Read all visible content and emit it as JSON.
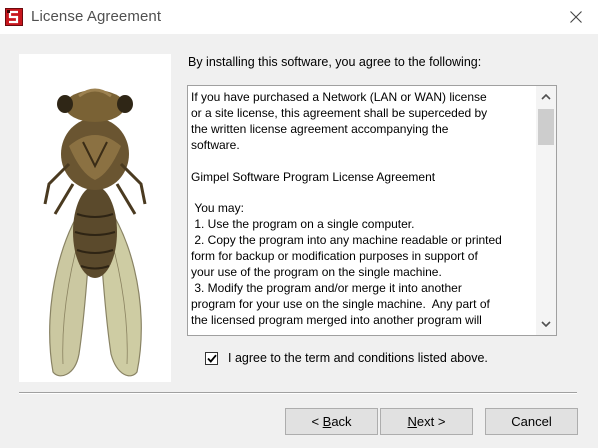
{
  "window": {
    "title": "License Agreement",
    "icon": "gimpel-app-icon",
    "close_icon": "close-icon"
  },
  "intro_text": "By installing this software, you agree to the following:",
  "license_text": "If you have purchased a Network (LAN or WAN) license\nor a site license, this agreement shall be superceded by\nthe written license agreement accompanying the\nsoftware.\n\nGimpel Software Program License Agreement\n\n You may:\n 1. Use the program on a single computer.\n 2. Copy the program into any machine readable or printed\nform for backup or modification purposes in support of\nyour use of the program on the single machine.\n 3. Modify the program and/or merge it into another\nprogram for your use on the single machine.  Any part of\nthe licensed program merged into another program will",
  "agree": {
    "checked": true,
    "label": "I agree to the term and conditions listed above."
  },
  "buttons": {
    "back": {
      "prefix": "< ",
      "accel": "B",
      "rest": "ack"
    },
    "next": {
      "accel": "N",
      "rest": "ext >"
    },
    "cancel": "Cancel"
  },
  "colors": {
    "client_bg": "#f0f0f0",
    "icon_red": "#c8161d"
  }
}
